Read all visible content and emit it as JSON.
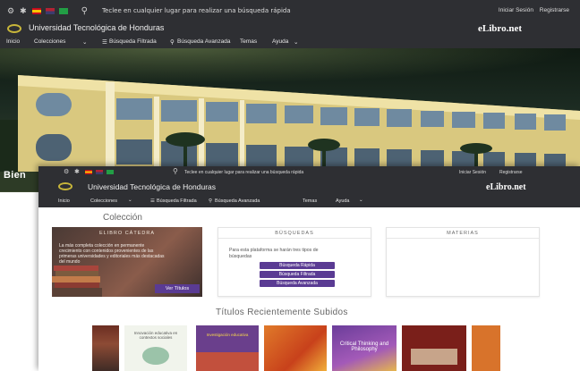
{
  "topbar": {
    "search_hint": "Teclee en cualquier lugar para realizar una búsqueda rápida",
    "login": "Iniciar Sesión",
    "register": "Registrarse"
  },
  "brand": {
    "university": "Universidad Tecnológica de Honduras",
    "site": "eLibro.net"
  },
  "nav": {
    "home": "Inicio",
    "collections": "Colecciones",
    "filtered_search": "Búsqueda Filtrada",
    "advanced_search": "Búsqueda Avanzada",
    "topics": "Temas",
    "help": "Ayuda"
  },
  "hero": {
    "welcome": "Bien"
  },
  "collection": {
    "title": "Colección",
    "catedra": {
      "title": "ELIBRO CÁTEDRA",
      "text": "La más completa colección en permanente crecimiento con contenidos provenientes de las primeras universidades y editoriales más destacadas del mundo",
      "button": "Ver Títulos"
    },
    "busquedas": {
      "title": "BÚSQUEDAS",
      "text": "Para esta plataforma se harán tres tipos de búsquedas",
      "buttons": [
        "Búsqueda Rápida",
        "Búsqueda Filtrada",
        "Búsqueda Avanzada"
      ]
    },
    "materias": {
      "title": "MATERIAS"
    }
  },
  "recent": {
    "title": "Títulos Recientemente Subidos",
    "covers": [
      {
        "title": "",
        "color": "#7b3b2a"
      },
      {
        "title": "Innovación educativa en contextos sociales",
        "color": "#f1f4ec"
      },
      {
        "title": "Investigación educativa",
        "color": "#6a3f8c"
      },
      {
        "title": "",
        "color": "#d55a1e"
      },
      {
        "title": "Critical Thinking and Philosophy",
        "color": "#6b3d9a"
      },
      {
        "title": "",
        "color": "#7a1f1a"
      },
      {
        "title": "",
        "color": "#d8732b"
      }
    ]
  },
  "colors": {
    "dark_bar": "#2e2f33",
    "accent": "#5a3b93",
    "logo": "#c8b63a"
  }
}
